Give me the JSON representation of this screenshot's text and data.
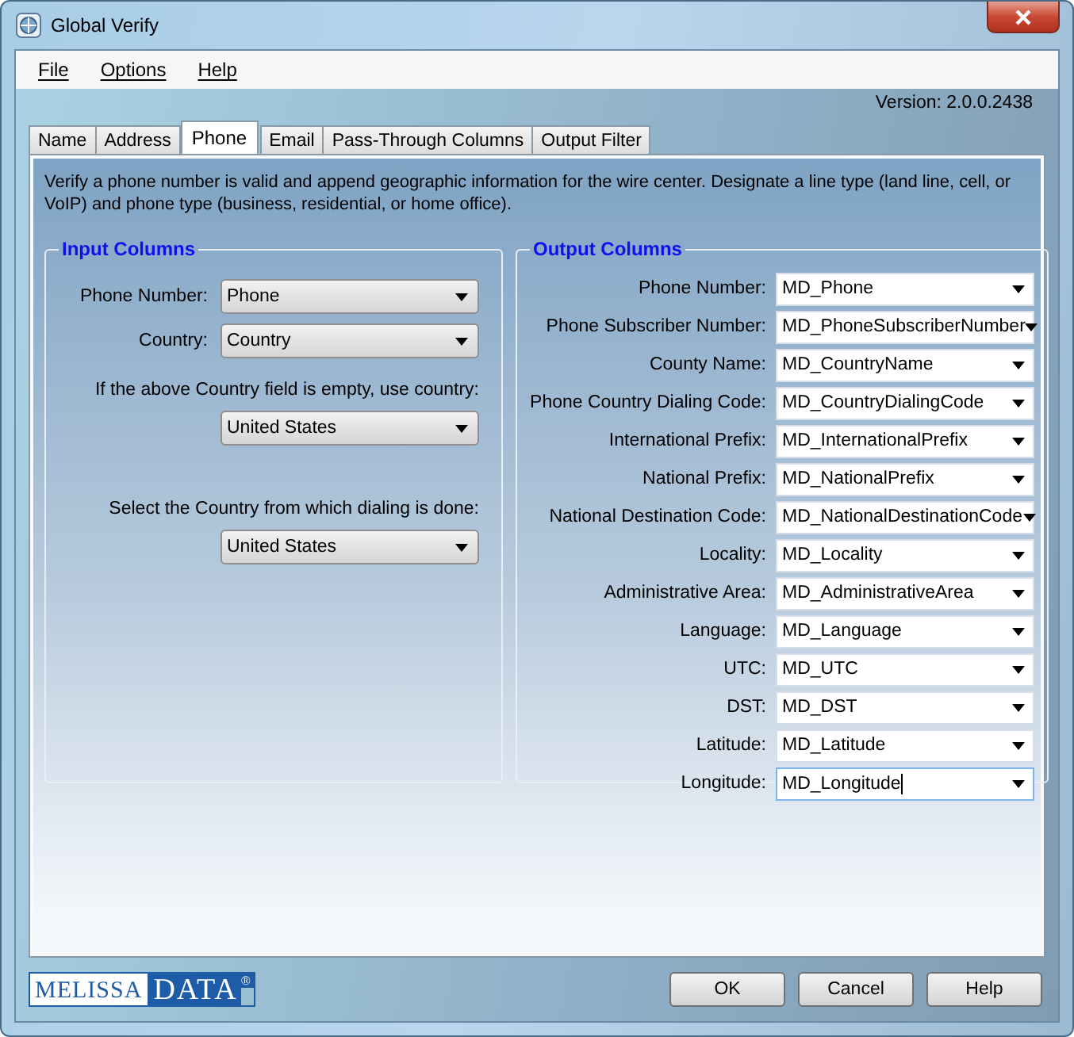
{
  "window": {
    "title": "Global Verify"
  },
  "menu": [
    "File",
    "Options",
    "Help"
  ],
  "version": "Version: 2.0.0.2438",
  "tabs": [
    {
      "label": "Name",
      "selected": false
    },
    {
      "label": "Address",
      "selected": false
    },
    {
      "label": "Phone",
      "selected": true
    },
    {
      "label": "Email",
      "selected": false
    },
    {
      "label": "Pass-Through Columns",
      "selected": false
    },
    {
      "label": "Output Filter",
      "selected": false
    }
  ],
  "description": "Verify a phone number is valid and append geographic information for the wire center. Designate a line type (land line, cell, or VoIP) and phone type (business, residential, or home office).",
  "input_columns": {
    "title": "Input Columns",
    "fields": [
      {
        "kind": "inline",
        "label": "Phone Number:",
        "value": "Phone"
      },
      {
        "kind": "inline",
        "label": "Country:",
        "value": "Country"
      },
      {
        "kind": "stacked",
        "label": "If the above Country field is  empty, use country:",
        "value": "United States"
      },
      {
        "kind": "stacked",
        "label": "Select the Country from which dialing is done:",
        "value": "United States"
      }
    ]
  },
  "output_columns": {
    "title": "Output Columns",
    "fields": [
      {
        "label": "Phone Number:",
        "value": "MD_Phone",
        "focused": false
      },
      {
        "label": "Phone Subscriber Number:",
        "value": "MD_PhoneSubscriberNumber",
        "focused": false
      },
      {
        "label": "County Name:",
        "value": "MD_CountryName",
        "focused": false
      },
      {
        "label": "Phone Country Dialing Code:",
        "value": "MD_CountryDialingCode",
        "focused": false
      },
      {
        "label": "International Prefix:",
        "value": "MD_InternationalPrefix",
        "focused": false
      },
      {
        "label": "National Prefix:",
        "value": "MD_NationalPrefix",
        "focused": false
      },
      {
        "label": "National Destination Code:",
        "value": "MD_NationalDestinationCode",
        "focused": false
      },
      {
        "label": "Locality:",
        "value": "MD_Locality",
        "focused": false
      },
      {
        "label": "Administrative Area:",
        "value": "MD_AdministrativeArea",
        "focused": false
      },
      {
        "label": "Language:",
        "value": "MD_Language",
        "focused": false
      },
      {
        "label": "UTC:",
        "value": "MD_UTC",
        "focused": false
      },
      {
        "label": "DST:",
        "value": "MD_DST",
        "focused": false
      },
      {
        "label": "Latitude:",
        "value": "MD_Latitude",
        "focused": false
      },
      {
        "label": "Longitude:",
        "value": "MD_Longitude",
        "focused": true
      }
    ]
  },
  "logo": {
    "left": "MELISSA",
    "right": "DATA",
    "mark": "®"
  },
  "buttons": [
    "OK",
    "Cancel",
    "Help"
  ]
}
